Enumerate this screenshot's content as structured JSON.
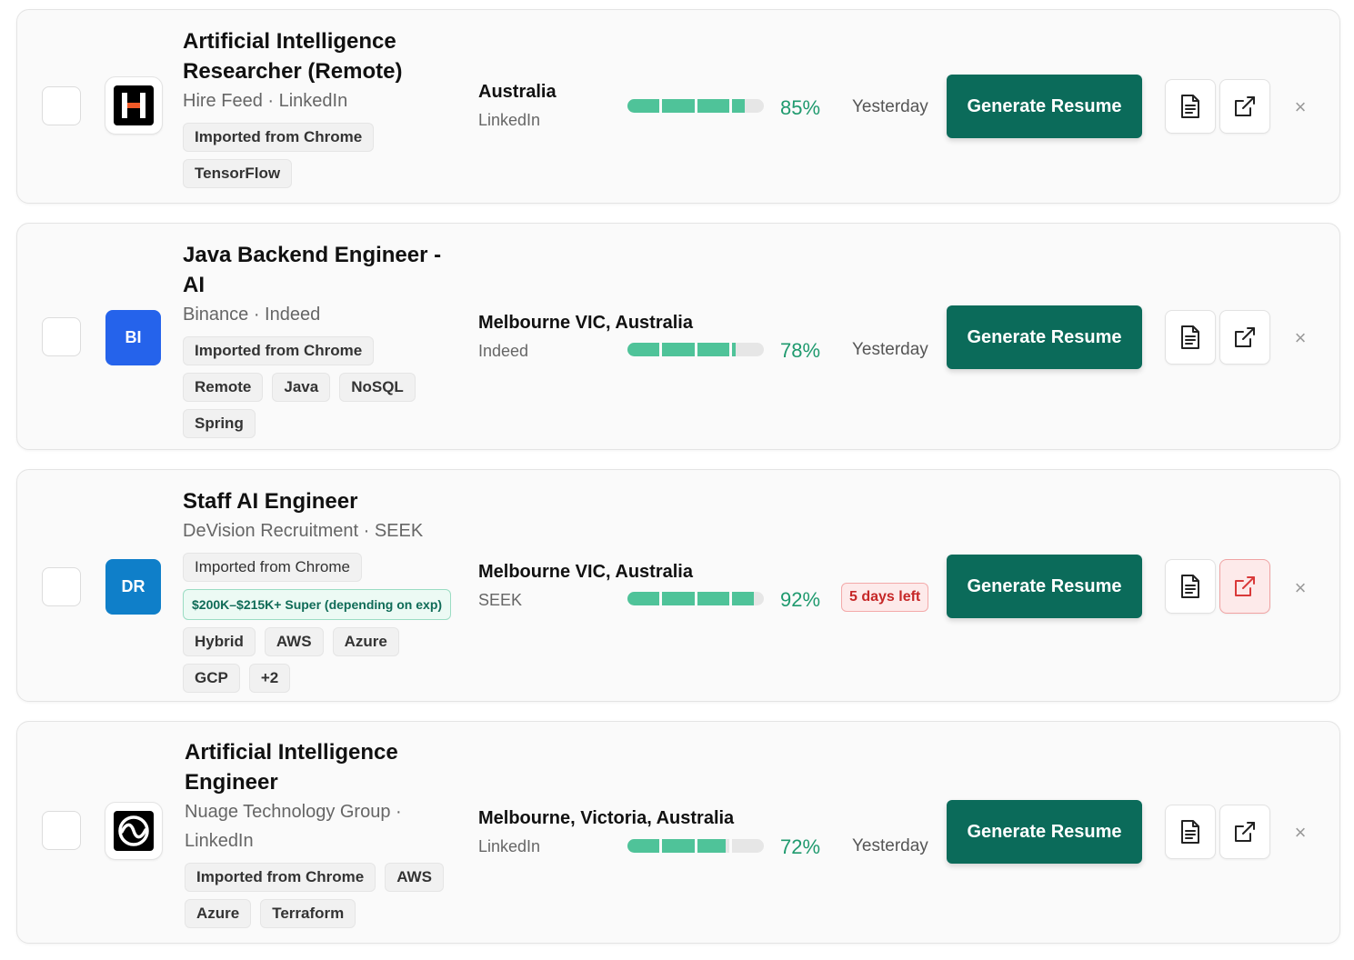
{
  "jobs": [
    {
      "title": "Artificial Intelligence Researcher (Remote)",
      "company": "Hire Feed · LinkedIn",
      "logo": {
        "type": "image",
        "icon": "hirefeed-logo-icon"
      },
      "tags": [
        "Imported from Chrome",
        "TensorFlow"
      ],
      "location": "Australia",
      "source": "LinkedIn",
      "match": {
        "percent": 85,
        "label": "85%"
      },
      "date": "Yesterday",
      "generate_label": "Generate Resume"
    },
    {
      "title": "Java Backend Engineer - AI",
      "company": "Binance · Indeed",
      "logo": {
        "type": "initials",
        "text": "BI",
        "color": "#2563eb"
      },
      "tags": [
        "Imported from Chrome",
        "Remote",
        "Java",
        "NoSQL",
        "Spring"
      ],
      "location": "Melbourne VIC, Australia",
      "source": "Indeed",
      "match": {
        "percent": 78,
        "label": "78%"
      },
      "date": "Yesterday",
      "generate_label": "Generate Resume"
    },
    {
      "title": "Staff AI Engineer",
      "company": "DeVision Recruitment · SEEK",
      "logo": {
        "type": "initials",
        "text": "DR",
        "color": "#0f7fc9"
      },
      "tags": [
        "Imported from Chrome",
        "Hybrid",
        "AWS",
        "Azure",
        "GCP",
        "+2"
      ],
      "salary": "$200K–$215K+ Super (depending on exp)",
      "location": "Melbourne VIC, Australia",
      "source": "SEEK",
      "match": {
        "percent": 92,
        "label": "92%"
      },
      "deadline": "5 days left",
      "generate_label": "Generate Resume"
    },
    {
      "title": "Artificial Intelligence Engineer",
      "company": "Nuage Technology Group · LinkedIn",
      "logo": {
        "type": "image",
        "icon": "wave-logo-icon"
      },
      "tags": [
        "Imported from Chrome",
        "AWS",
        "Azure",
        "Terraform"
      ],
      "location": "Melbourne, Victoria, Australia",
      "source": "LinkedIn",
      "match": {
        "percent": 72,
        "label": "72%"
      },
      "date": "Yesterday",
      "generate_label": "Generate Resume"
    }
  ],
  "actions": {
    "document_icon": "document-icon",
    "external_link_icon": "external-link-icon",
    "close_label": "×"
  },
  "colors": {
    "accent": "#0b6b5a",
    "match_bar": "#4fc399",
    "match_text": "#1f9a6e",
    "deadline": "#c62828"
  }
}
